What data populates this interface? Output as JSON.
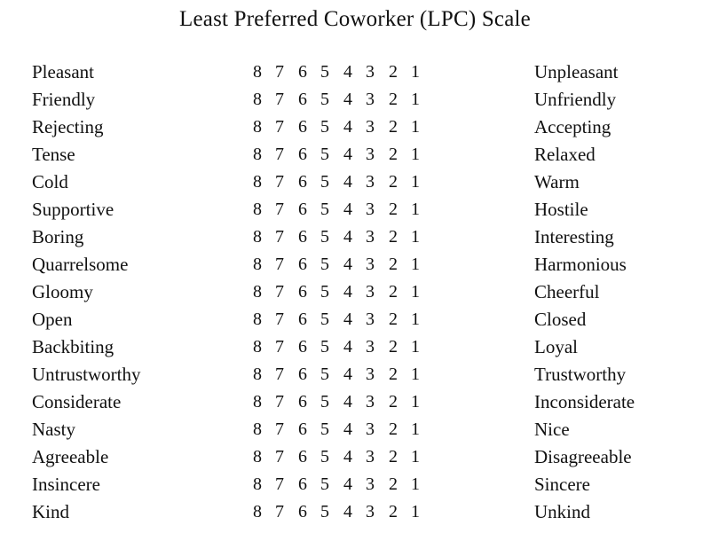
{
  "title": "Least Preferred Coworker (LPC) Scale",
  "scale": {
    "points": [
      "8",
      "7",
      "6",
      "5",
      "4",
      "3",
      "2",
      "1"
    ],
    "high_anchor": "8",
    "low_anchor": "1"
  },
  "colors": {
    "background": "#ffffff",
    "text": "#111111"
  },
  "items": [
    {
      "left": "Pleasant",
      "right": "Unpleasant"
    },
    {
      "left": "Friendly",
      "right": "Unfriendly"
    },
    {
      "left": "Rejecting",
      "right": "Accepting"
    },
    {
      "left": "Tense",
      "right": "Relaxed"
    },
    {
      "left": "Cold",
      "right": "Warm"
    },
    {
      "left": "Supportive",
      "right": "Hostile"
    },
    {
      "left": "Boring",
      "right": "Interesting"
    },
    {
      "left": "Quarrelsome",
      "right": "Harmonious"
    },
    {
      "left": "Gloomy",
      "right": "Cheerful"
    },
    {
      "left": "Open",
      "right": "Closed"
    },
    {
      "left": "Backbiting",
      "right": "Loyal"
    },
    {
      "left": "Untrustworthy",
      "right": "Trustworthy"
    },
    {
      "left": "Considerate",
      "right": "Inconsiderate"
    },
    {
      "left": "Nasty",
      "right": "Nice"
    },
    {
      "left": "Agreeable",
      "right": "Disagreeable"
    },
    {
      "left": "Insincere",
      "right": "Sincere"
    },
    {
      "left": "Kind",
      "right": "Unkind"
    }
  ]
}
